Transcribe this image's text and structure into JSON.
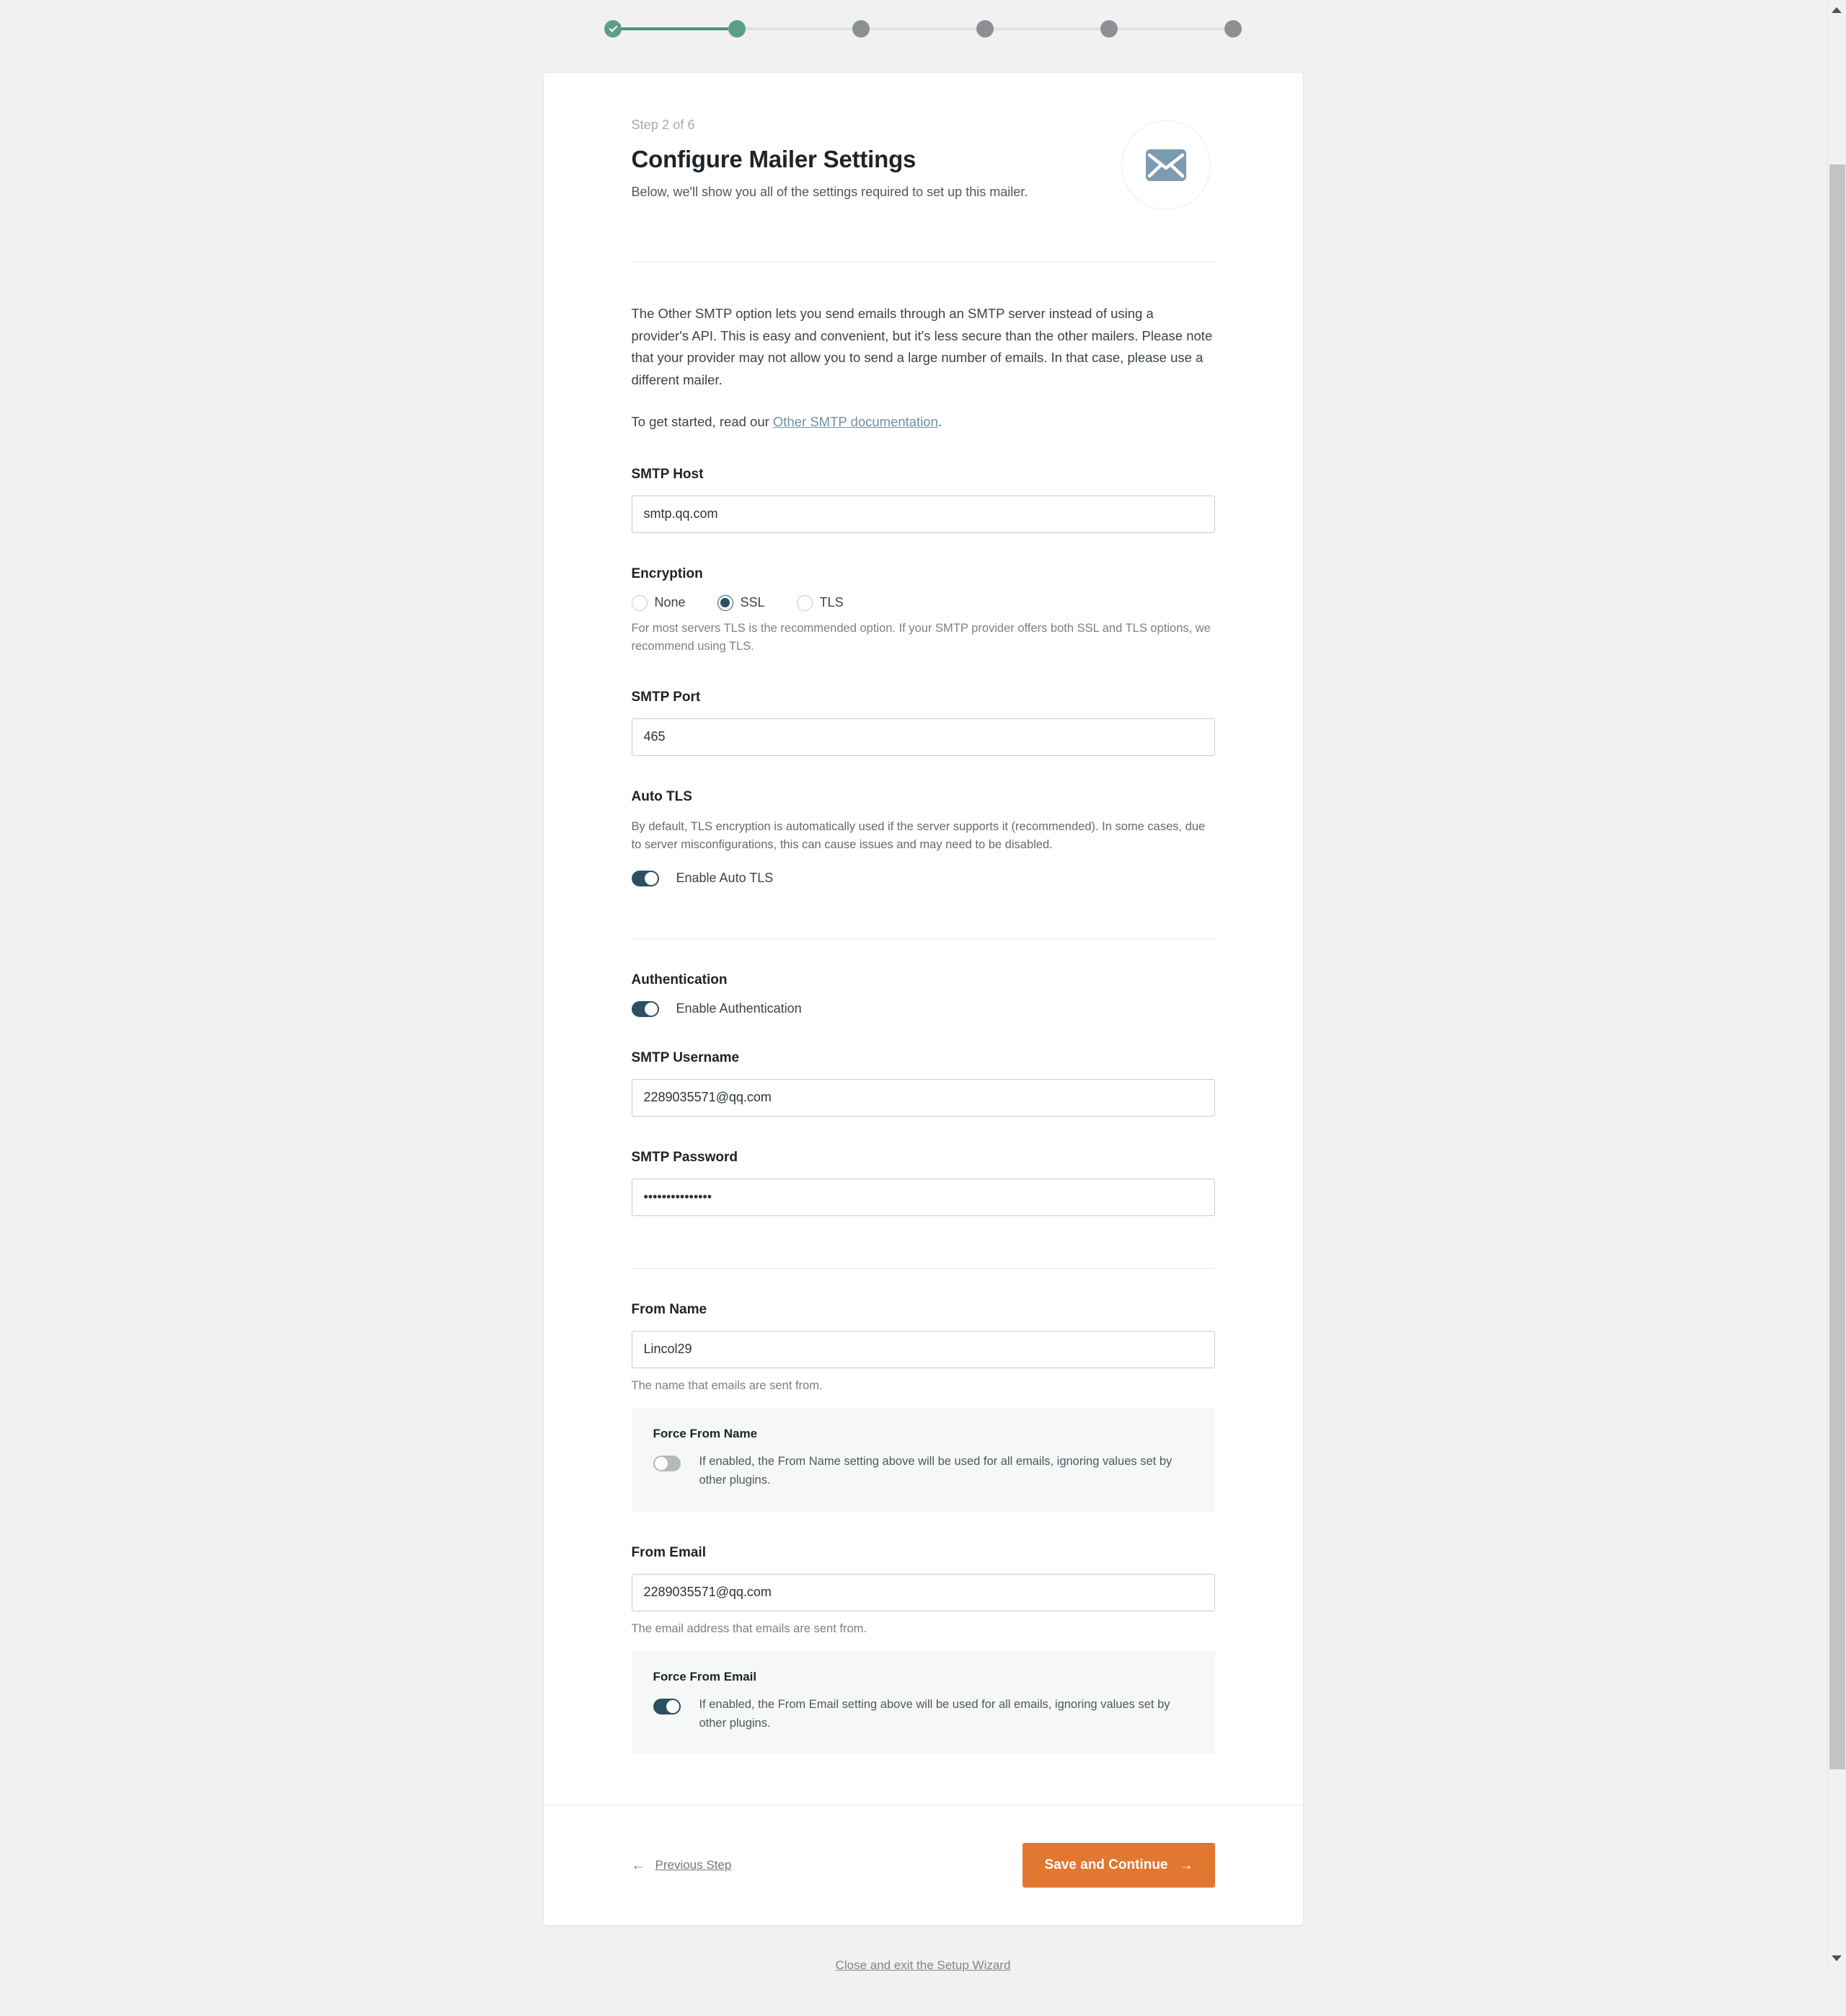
{
  "stepper": {
    "steps": [
      {
        "state": "done",
        "icon": "check-icon"
      },
      {
        "state": "active",
        "icon": ""
      },
      {
        "state": "pending",
        "icon": ""
      },
      {
        "state": "pending",
        "icon": ""
      },
      {
        "state": "pending",
        "icon": ""
      },
      {
        "state": "pending",
        "icon": ""
      }
    ],
    "colors": {
      "done": "#5c9e8a",
      "active": "#5c9e8a",
      "pending": "#8c8f94",
      "line_filled": "#4e9079",
      "line_empty": "#e0e0e0"
    }
  },
  "header": {
    "step_counter": "Step 2 of 6",
    "title": "Configure Mailer Settings",
    "subtitle": "Below, we'll show you all of the settings required to set up this mailer.",
    "badge_icon": "envelope-icon",
    "badge_color": "#7d9bb0"
  },
  "intro": {
    "paragraph": "The Other SMTP option lets you send emails through an SMTP server instead of using a provider's API. This is easy and convenient, but it's less secure than the other mailers. Please note that your provider may not allow you to send a large number of emails. In that case, please use a different mailer.",
    "cta_prefix": "To get started, read our ",
    "cta_link": "Other SMTP documentation",
    "cta_suffix": ".",
    "link_color": "#6e8fa8"
  },
  "fields": {
    "smtp_host": {
      "label": "SMTP Host",
      "value": "smtp.qq.com",
      "placeholder": "smtp.qq.com"
    },
    "encryption": {
      "label": "Encryption",
      "options": [
        "None",
        "SSL",
        "TLS"
      ],
      "selected": "SSL",
      "help": "For most servers TLS is the recommended option. If your SMTP provider offers both SSL and TLS options, we recommend using TLS.",
      "accent": "#2b5062"
    },
    "smtp_port": {
      "label": "SMTP Port",
      "value": "465",
      "placeholder": "465"
    },
    "auto_tls": {
      "label": "Auto TLS",
      "description": "By default, TLS encryption is automatically used if the server supports it (recommended). In some cases, due to server misconfigurations, this can cause issues and may need to be disabled.",
      "toggle_label": "Enable Auto TLS",
      "enabled": true
    },
    "authentication": {
      "label": "Authentication",
      "toggle_label": "Enable Authentication",
      "enabled": true
    },
    "smtp_username": {
      "label": "SMTP Username",
      "value": "2289035571@qq.com",
      "placeholder": "SMTP Username"
    },
    "smtp_password": {
      "label": "SMTP Password",
      "value": "•••••••••••••••",
      "placeholder": "SMTP Password"
    },
    "from_name": {
      "label": "From Name",
      "value": "Lincol29",
      "placeholder": "From Name",
      "help": "The name that emails are sent from."
    },
    "force_from_name": {
      "title": "Force From Name",
      "description": "If enabled, the From Name setting above will be used for all emails, ignoring values set by other plugins.",
      "enabled": false
    },
    "from_email": {
      "label": "From Email",
      "value": "2289035571@qq.com",
      "placeholder": "From Email",
      "help": "The email address that emails are sent from."
    },
    "force_from_email": {
      "title": "Force From Email",
      "description": "If enabled, the From Email setting above will be used for all emails, ignoring values set by other plugins.",
      "enabled": true
    }
  },
  "footer": {
    "previous_label": "Previous Step",
    "previous_icon": "arrow-left-icon",
    "save_label": "Save and Continue",
    "save_icon": "arrow-right-icon",
    "save_color": "#e27730"
  },
  "exit": {
    "label": "Close and exit the Setup Wizard"
  },
  "scrollbar": {
    "up_icon": "caret-up-icon",
    "down_icon": "caret-down-icon"
  }
}
